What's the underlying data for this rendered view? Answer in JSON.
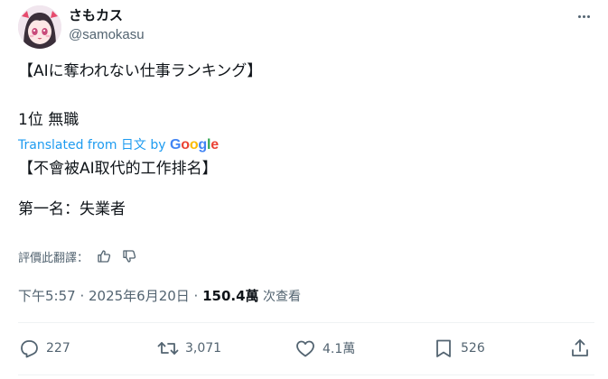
{
  "author": {
    "display_name": "さもカス",
    "handle": "@samokasu",
    "avatar_icon": "anime-girl-avatar"
  },
  "tweet": {
    "original_line1": "【AIに奪われない仕事ランキング】",
    "original_line2": "1位 無職",
    "translated_from": "Translated from 日文 by",
    "translator_logo": "Google",
    "translated_line1": "【不會被AI取代的工作排名】",
    "translated_line2": "第一名：失業者"
  },
  "rating": {
    "label": "評價此翻譯：",
    "thumbs_up_icon": "thumbs-up-icon",
    "thumbs_down_icon": "thumbs-down-icon"
  },
  "meta": {
    "timestamp": "下午5:57 · 2025年6月20日 · ",
    "views_count": "150.4萬",
    "views_label": " 次查看"
  },
  "actions": {
    "replies": "227",
    "reposts": "3,071",
    "likes": "4.1萬",
    "bookmarks": "526"
  },
  "colors": {
    "link_blue": "#1d9bf0",
    "secondary_text": "#536471",
    "primary_text": "#0f1419",
    "google_blue": "#4285F4",
    "google_red": "#EA4335",
    "google_yellow": "#FBBC05",
    "google_green": "#34A853"
  }
}
